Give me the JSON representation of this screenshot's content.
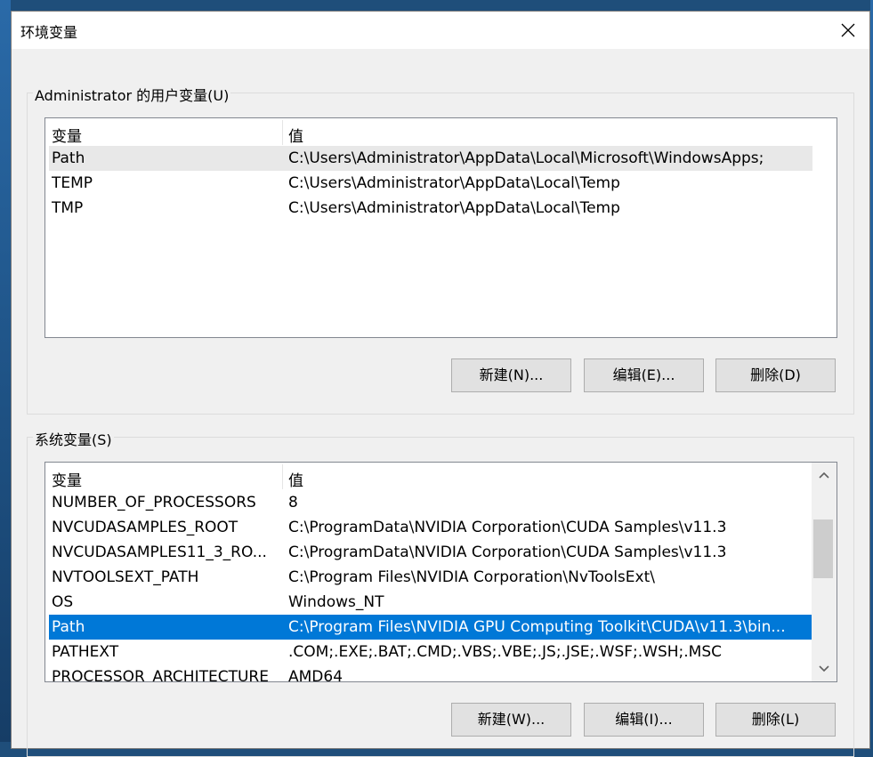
{
  "window": {
    "title": "环境变量",
    "close_icon": "close-icon"
  },
  "user_vars": {
    "group_label": "Administrator 的用户变量(U)",
    "columns": [
      "变量",
      "值"
    ],
    "rows": [
      {
        "name": "Path",
        "value": "C:\\Users\\Administrator\\AppData\\Local\\Microsoft\\WindowsApps;"
      },
      {
        "name": "TEMP",
        "value": "C:\\Users\\Administrator\\AppData\\Local\\Temp"
      },
      {
        "name": "TMP",
        "value": "C:\\Users\\Administrator\\AppData\\Local\\Temp"
      }
    ],
    "buttons": {
      "new": "新建(N)...",
      "edit": "编辑(E)...",
      "delete": "删除(D)"
    }
  },
  "system_vars": {
    "group_label": "系统变量(S)",
    "columns": [
      "变量",
      "值"
    ],
    "rows": [
      {
        "name": "NUMBER_OF_PROCESSORS",
        "value": "8"
      },
      {
        "name": "NVCUDASAMPLES_ROOT",
        "value": "C:\\ProgramData\\NVIDIA Corporation\\CUDA Samples\\v11.3"
      },
      {
        "name": "NVCUDASAMPLES11_3_RO...",
        "value": "C:\\ProgramData\\NVIDIA Corporation\\CUDA Samples\\v11.3"
      },
      {
        "name": "NVTOOLSEXT_PATH",
        "value": "C:\\Program Files\\NVIDIA Corporation\\NvToolsExt\\"
      },
      {
        "name": "OS",
        "value": "Windows_NT"
      },
      {
        "name": "Path",
        "value": "C:\\Program Files\\NVIDIA GPU Computing Toolkit\\CUDA\\v11.3\\bin..."
      },
      {
        "name": "PATHEXT",
        "value": ".COM;.EXE;.BAT;.CMD;.VBS;.VBE;.JS;.JSE;.WSF;.WSH;.MSC"
      },
      {
        "name": "PROCESSOR_ARCHITECTURE",
        "value": "AMD64"
      }
    ],
    "buttons": {
      "new": "新建(W)...",
      "edit": "编辑(I)...",
      "delete": "删除(L)"
    }
  },
  "colors": {
    "selection": "#0078d7",
    "hover": "#e8e8e8",
    "dialog_bg": "#f0f0f0"
  }
}
